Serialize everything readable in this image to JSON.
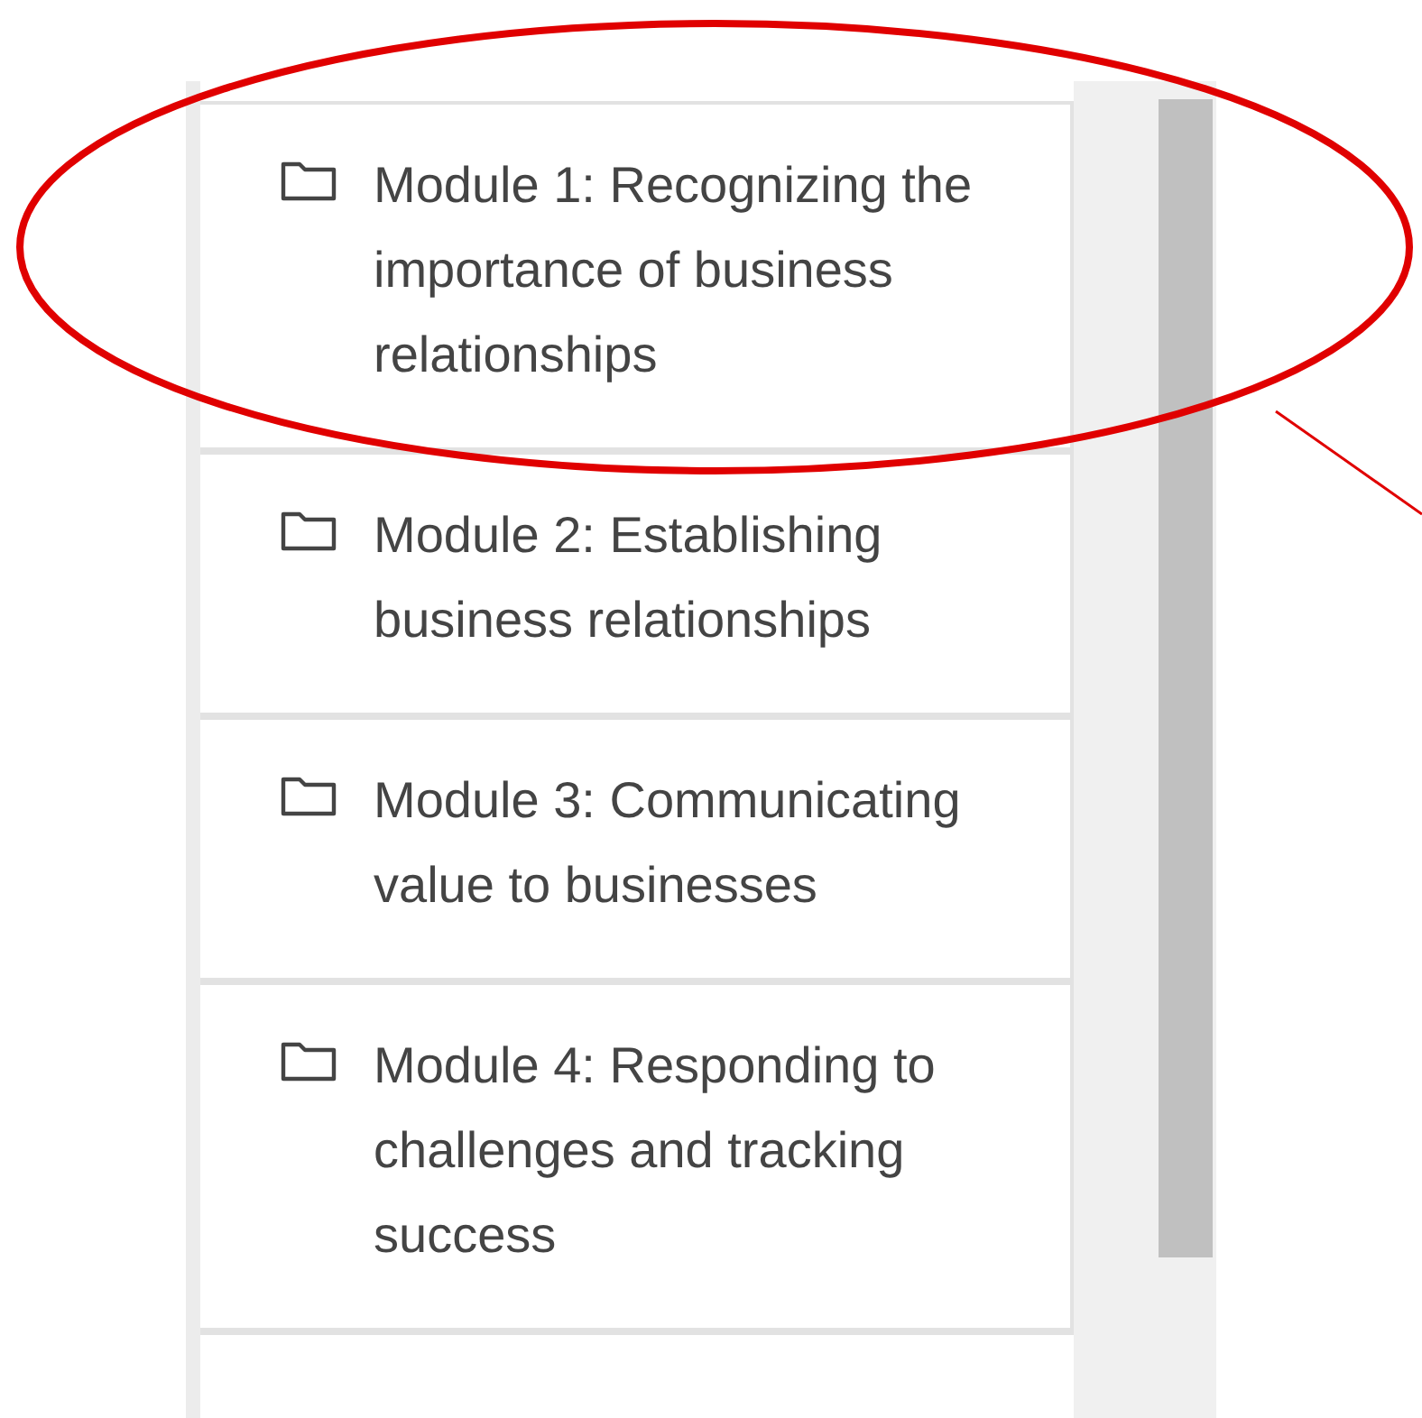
{
  "modules": [
    {
      "title": "Module 1: Recognizing the importance of business relationships"
    },
    {
      "title": "Module 2: Establishing business relationships"
    },
    {
      "title": "Module 3: Communicating value to businesses"
    },
    {
      "title": "Module 4: Responding to challenges and tracking success"
    }
  ]
}
